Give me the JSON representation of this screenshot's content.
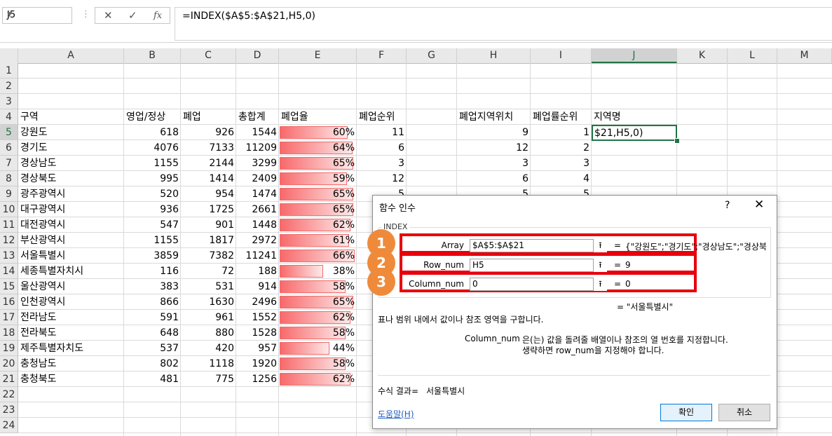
{
  "formula_bar": {
    "name_box": "J5",
    "cancel_icon": "✕",
    "enter_icon": "✓",
    "fx_icon": "fx",
    "formula": "=INDEX($A$5:$A$21,H5,0)"
  },
  "columns": [
    "A",
    "B",
    "C",
    "D",
    "E",
    "F",
    "G",
    "H",
    "I",
    "J",
    "K",
    "L",
    "M"
  ],
  "rows": [
    "1",
    "2",
    "3",
    "4",
    "5",
    "6",
    "7",
    "8",
    "9",
    "10",
    "11",
    "12",
    "13",
    "14",
    "15",
    "16",
    "17",
    "18",
    "19",
    "20",
    "21",
    "22",
    "23",
    "24"
  ],
  "headers": {
    "a": "구역",
    "b": "영업/정상",
    "c": "폐업",
    "d": "총합계",
    "e": "폐업율",
    "f": "폐업순위",
    "h": "폐업지역위치",
    "i": "폐업률순위",
    "j": "지역명"
  },
  "data_rows": [
    {
      "a": "강원도",
      "b": "618",
      "c": "926",
      "d": "1544",
      "e": "60%",
      "e_val": 0.6,
      "f": "11",
      "h": "9",
      "i": "1"
    },
    {
      "a": "경기도",
      "b": "4076",
      "c": "7133",
      "d": "11209",
      "e": "64%",
      "e_val": 0.64,
      "f": "6",
      "h": "12",
      "i": "2"
    },
    {
      "a": "경상남도",
      "b": "1155",
      "c": "2144",
      "d": "3299",
      "e": "65%",
      "e_val": 0.65,
      "f": "3",
      "h": "3",
      "i": "3"
    },
    {
      "a": "경상북도",
      "b": "995",
      "c": "1414",
      "d": "2409",
      "e": "59%",
      "e_val": 0.59,
      "f": "12",
      "h": "6",
      "i": "4"
    },
    {
      "a": "광주광역시",
      "b": "520",
      "c": "954",
      "d": "1474",
      "e": "65%",
      "e_val": 0.65,
      "f": "5",
      "h": "5",
      "i": "5"
    },
    {
      "a": "대구광역시",
      "b": "936",
      "c": "1725",
      "d": "2661",
      "e": "65%",
      "e_val": 0.65,
      "f": "",
      "h": "",
      "i": ""
    },
    {
      "a": "대전광역시",
      "b": "547",
      "c": "901",
      "d": "1448",
      "e": "62%",
      "e_val": 0.62,
      "f": "",
      "h": "",
      "i": ""
    },
    {
      "a": "부산광역시",
      "b": "1155",
      "c": "1817",
      "d": "2972",
      "e": "61%",
      "e_val": 0.61,
      "f": "",
      "h": "",
      "i": ""
    },
    {
      "a": "서울특별시",
      "b": "3859",
      "c": "7382",
      "d": "11241",
      "e": "66%",
      "e_val": 0.66,
      "f": "",
      "h": "",
      "i": ""
    },
    {
      "a": "세종특별자치시",
      "b": "116",
      "c": "72",
      "d": "188",
      "e": "38%",
      "e_val": 0.38,
      "f": "",
      "h": "",
      "i": ""
    },
    {
      "a": "울산광역시",
      "b": "383",
      "c": "531",
      "d": "914",
      "e": "58%",
      "e_val": 0.58,
      "f": "",
      "h": "",
      "i": ""
    },
    {
      "a": "인천광역시",
      "b": "866",
      "c": "1630",
      "d": "2496",
      "e": "65%",
      "e_val": 0.65,
      "f": "",
      "h": "",
      "i": ""
    },
    {
      "a": "전라남도",
      "b": "591",
      "c": "961",
      "d": "1552",
      "e": "62%",
      "e_val": 0.62,
      "f": "",
      "h": "",
      "i": ""
    },
    {
      "a": "전라북도",
      "b": "648",
      "c": "880",
      "d": "1528",
      "e": "58%",
      "e_val": 0.58,
      "f": "",
      "h": "",
      "i": ""
    },
    {
      "a": "제주특별자치도",
      "b": "537",
      "c": "420",
      "d": "957",
      "e": "44%",
      "e_val": 0.44,
      "f": "",
      "h": "",
      "i": ""
    },
    {
      "a": "충청남도",
      "b": "802",
      "c": "1118",
      "d": "1920",
      "e": "58%",
      "e_val": 0.58,
      "f": "",
      "h": "",
      "i": ""
    },
    {
      "a": "충청북도",
      "b": "481",
      "c": "775",
      "d": "1256",
      "e": "62%",
      "e_val": 0.62,
      "f": "",
      "h": "",
      "i": ""
    }
  ],
  "active_cell_text": "$21,H5,0)",
  "dialog": {
    "title": "함수 인수",
    "help_icon": "?",
    "close_icon": "✕",
    "function_name": "INDEX",
    "args": [
      {
        "badge": "1",
        "label": "Array",
        "value": "$A$5:$A$21",
        "eq": "=",
        "result": "{\"강원도\";\"경기도\";\"경상남도\";\"경상북"
      },
      {
        "badge": "2",
        "label": "Row_num",
        "value": "H5",
        "eq": "=",
        "result": "9"
      },
      {
        "badge": "3",
        "label": "Column_num",
        "value": "0",
        "eq": "=",
        "result": "0"
      }
    ],
    "collapse_icon": "⭱",
    "function_result": "=  \"서울특별시\"",
    "description": "표나 범위 내에서 값이나 참조 영역을 구합니다.",
    "arg_name": "Column_num",
    "arg_desc_1": "은(는) 값을 돌려줄 배열이나 참조의 열 번호를 지정합니다.",
    "arg_desc_2": "생략하면 row_num을 지정해야 합니다.",
    "formula_result_label": "수식 결과=",
    "formula_result_value": "서울특별시",
    "help_link": "도움말(H)",
    "ok_label": "확인",
    "cancel_label": "취소"
  },
  "colors": {
    "selection": "#217346",
    "bar": "#f8696b",
    "highlight": "#e8000b",
    "badge": "#ef8a3b"
  }
}
